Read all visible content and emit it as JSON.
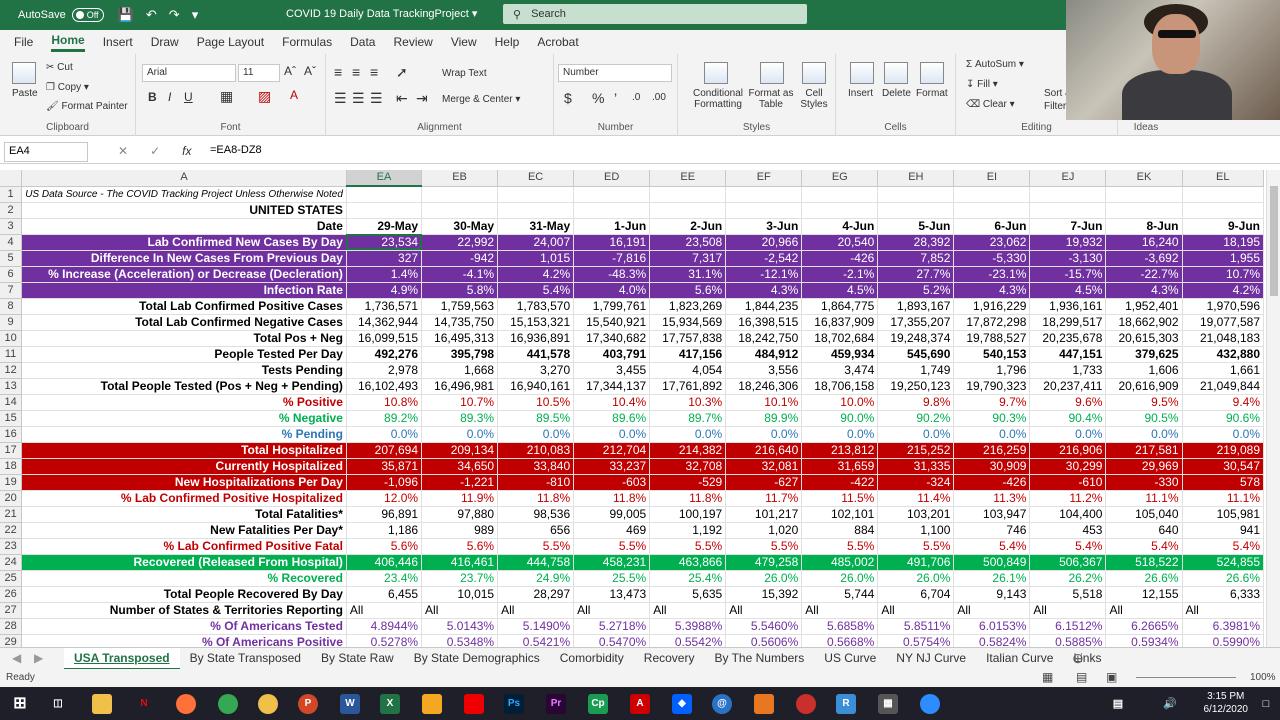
{
  "titlebar": {
    "autosave_label": "AutoSave",
    "autosave_state": "Off",
    "doc_title": "COVID 19 Daily Data TrackingProject",
    "search_placeholder": "Search"
  },
  "ribbon_tabs": [
    "File",
    "Home",
    "Insert",
    "Draw",
    "Page Layout",
    "Formulas",
    "Data",
    "Review",
    "View",
    "Help",
    "Acrobat"
  ],
  "ribbon": {
    "clipboard": {
      "paste": "Paste",
      "cut": "Cut",
      "copy": "Copy",
      "format_painter": "Format Painter",
      "label": "Clipboard"
    },
    "font": {
      "name": "Arial",
      "size": "11",
      "label": "Font"
    },
    "alignment": {
      "wrap": "Wrap Text",
      "merge": "Merge & Center",
      "label": "Alignment"
    },
    "number": {
      "format": "Number",
      "label": "Number"
    },
    "styles": {
      "conditional": "Conditional Formatting",
      "format_table": "Format as Table",
      "cell_styles": "Cell Styles",
      "label": "Styles"
    },
    "cells": {
      "insert": "Insert",
      "delete": "Delete",
      "format": "Format",
      "label": "Cells"
    },
    "editing": {
      "autosum": "AutoSum",
      "fill": "Fill",
      "clear": "Clear",
      "sort": "Sort &",
      "filter": "Filter",
      "label": "Editing"
    },
    "ideas": {
      "label": "Ideas"
    }
  },
  "formulabar": {
    "namebox": "EA4",
    "formula": "=EA8-DZ8"
  },
  "columns": [
    "A",
    "EA",
    "EB",
    "EC",
    "ED",
    "EE",
    "EF",
    "EG",
    "EH",
    "EI",
    "EJ",
    "EK",
    "EL"
  ],
  "rows": [
    {
      "n": "1",
      "label": "US Data Source - The COVID Tracking Project Unless Otherwise Noted",
      "style": "note",
      "vals": [
        "",
        "",
        "",
        "",
        "",
        "",
        "",
        "",
        "",
        "",
        "",
        ""
      ]
    },
    {
      "n": "2",
      "label": "UNITED STATES",
      "style": "bold",
      "vals": [
        "",
        "",
        "",
        "",
        "",
        "",
        "",
        "",
        "",
        "",
        "",
        ""
      ]
    },
    {
      "n": "3",
      "label": "Date",
      "style": "bold",
      "vals": [
        "29-May",
        "30-May",
        "31-May",
        "1-Jun",
        "2-Jun",
        "3-Jun",
        "4-Jun",
        "5-Jun",
        "6-Jun",
        "7-Jun",
        "8-Jun",
        "9-Jun"
      ],
      "valbold": true
    },
    {
      "n": "4",
      "label": "Lab Confirmed New Cases By Day",
      "style": "purple",
      "vals": [
        "23,534",
        "22,992",
        "24,007",
        "16,191",
        "23,508",
        "20,966",
        "20,540",
        "28,392",
        "23,062",
        "19,932",
        "16,240",
        "18,195"
      ]
    },
    {
      "n": "5",
      "label": "Difference In New Cases From Previous Day",
      "style": "purple",
      "vals": [
        "327",
        "-942",
        "1,015",
        "-7,816",
        "7,317",
        "-2,542",
        "-426",
        "7,852",
        "-5,330",
        "-3,130",
        "-3,692",
        "1,955"
      ]
    },
    {
      "n": "6",
      "label": "% Increase (Acceleration) or Decrease (Decleration)",
      "style": "purple",
      "vals": [
        "1.4%",
        "-4.1%",
        "4.2%",
        "-48.3%",
        "31.1%",
        "-12.1%",
        "-2.1%",
        "27.7%",
        "-23.1%",
        "-15.7%",
        "-22.7%",
        "10.7%"
      ]
    },
    {
      "n": "7",
      "label": "Infection Rate",
      "style": "purple",
      "vals": [
        "4.9%",
        "5.8%",
        "5.4%",
        "4.0%",
        "5.6%",
        "4.3%",
        "4.5%",
        "5.2%",
        "4.3%",
        "4.5%",
        "4.3%",
        "4.2%"
      ]
    },
    {
      "n": "8",
      "label": "Total Lab Confirmed Positive Cases",
      "style": "bold",
      "vals": [
        "1,736,571",
        "1,759,563",
        "1,783,570",
        "1,799,761",
        "1,823,269",
        "1,844,235",
        "1,864,775",
        "1,893,167",
        "1,916,229",
        "1,936,161",
        "1,952,401",
        "1,970,596"
      ]
    },
    {
      "n": "9",
      "label": "Total Lab Confirmed Negative Cases",
      "style": "bold",
      "vals": [
        "14,362,944",
        "14,735,750",
        "15,153,321",
        "15,540,921",
        "15,934,569",
        "16,398,515",
        "16,837,909",
        "17,355,207",
        "17,872,298",
        "18,299,517",
        "18,662,902",
        "19,077,587"
      ]
    },
    {
      "n": "10",
      "label": "Total Pos + Neg",
      "style": "bold",
      "vals": [
        "16,099,515",
        "16,495,313",
        "16,936,891",
        "17,340,682",
        "17,757,838",
        "18,242,750",
        "18,702,684",
        "19,248,374",
        "19,788,527",
        "20,235,678",
        "20,615,303",
        "21,048,183"
      ]
    },
    {
      "n": "11",
      "label": "People Tested Per Day",
      "style": "bold",
      "vals": [
        "492,276",
        "395,798",
        "441,578",
        "403,791",
        "417,156",
        "484,912",
        "459,934",
        "545,690",
        "540,153",
        "447,151",
        "379,625",
        "432,880"
      ],
      "valbold": true
    },
    {
      "n": "12",
      "label": "Tests Pending",
      "style": "bold",
      "vals": [
        "2,978",
        "1,668",
        "3,270",
        "3,455",
        "4,054",
        "3,556",
        "3,474",
        "1,749",
        "1,796",
        "1,733",
        "1,606",
        "1,661"
      ]
    },
    {
      "n": "13",
      "label": "Total People Tested (Pos + Neg + Pending)",
      "style": "bold",
      "vals": [
        "16,102,493",
        "16,496,981",
        "16,940,161",
        "17,344,137",
        "17,761,892",
        "18,246,306",
        "18,706,158",
        "19,250,123",
        "19,790,323",
        "20,237,411",
        "20,616,909",
        "21,049,844"
      ]
    },
    {
      "n": "14",
      "label": "% Positive",
      "style": "red",
      "vals": [
        "10.8%",
        "10.7%",
        "10.5%",
        "10.4%",
        "10.3%",
        "10.1%",
        "10.0%",
        "9.8%",
        "9.7%",
        "9.6%",
        "9.5%",
        "9.4%"
      ]
    },
    {
      "n": "15",
      "label": "% Negative",
      "style": "green",
      "vals": [
        "89.2%",
        "89.3%",
        "89.5%",
        "89.6%",
        "89.7%",
        "89.9%",
        "90.0%",
        "90.2%",
        "90.3%",
        "90.4%",
        "90.5%",
        "90.6%"
      ]
    },
    {
      "n": "16",
      "label": "% Pending",
      "style": "blue",
      "vals": [
        "0.0%",
        "0.0%",
        "0.0%",
        "0.0%",
        "0.0%",
        "0.0%",
        "0.0%",
        "0.0%",
        "0.0%",
        "0.0%",
        "0.0%",
        "0.0%"
      ]
    },
    {
      "n": "17",
      "label": "Total Hospitalized",
      "style": "redfill",
      "vals": [
        "207,694",
        "209,134",
        "210,083",
        "212,704",
        "214,382",
        "216,640",
        "213,812",
        "215,252",
        "216,259",
        "216,906",
        "217,581",
        "219,089"
      ]
    },
    {
      "n": "18",
      "label": "Currently Hospitalized",
      "style": "redfill",
      "vals": [
        "35,871",
        "34,650",
        "33,840",
        "33,237",
        "32,708",
        "32,081",
        "31,659",
        "31,335",
        "30,909",
        "30,299",
        "29,969",
        "30,547"
      ]
    },
    {
      "n": "19",
      "label": "New Hospitalizations Per Day",
      "style": "redfill",
      "vals": [
        "-1,096",
        "-1,221",
        "-810",
        "-603",
        "-529",
        "-627",
        "-422",
        "-324",
        "-426",
        "-610",
        "-330",
        "578"
      ]
    },
    {
      "n": "20",
      "label": "% Lab Confirmed Positive Hospitalized",
      "style": "red",
      "vals": [
        "12.0%",
        "11.9%",
        "11.8%",
        "11.8%",
        "11.8%",
        "11.7%",
        "11.5%",
        "11.4%",
        "11.3%",
        "11.2%",
        "11.1%",
        "11.1%"
      ]
    },
    {
      "n": "21",
      "label": "Total Fatalities*",
      "style": "bold",
      "vals": [
        "96,891",
        "97,880",
        "98,536",
        "99,005",
        "100,197",
        "101,217",
        "102,101",
        "103,201",
        "103,947",
        "104,400",
        "105,040",
        "105,981"
      ]
    },
    {
      "n": "22",
      "label": "New Fatalities Per Day*",
      "style": "bold",
      "vals": [
        "1,186",
        "989",
        "656",
        "469",
        "1,192",
        "1,020",
        "884",
        "1,100",
        "746",
        "453",
        "640",
        "941"
      ]
    },
    {
      "n": "23",
      "label": "% Lab Confirmed Positive Fatal",
      "style": "red",
      "vals": [
        "5.6%",
        "5.6%",
        "5.5%",
        "5.5%",
        "5.5%",
        "5.5%",
        "5.5%",
        "5.5%",
        "5.4%",
        "5.4%",
        "5.4%",
        "5.4%"
      ]
    },
    {
      "n": "24",
      "label": "Recovered (Released From Hospital)",
      "style": "greenfill",
      "vals": [
        "406,446",
        "416,461",
        "444,758",
        "458,231",
        "463,866",
        "479,258",
        "485,002",
        "491,706",
        "500,849",
        "506,367",
        "518,522",
        "524,855"
      ]
    },
    {
      "n": "25",
      "label": "% Recovered",
      "style": "green",
      "vals": [
        "23.4%",
        "23.7%",
        "24.9%",
        "25.5%",
        "25.4%",
        "26.0%",
        "26.0%",
        "26.0%",
        "26.1%",
        "26.2%",
        "26.6%",
        "26.6%"
      ]
    },
    {
      "n": "26",
      "label": "Total People Recovered By Day",
      "style": "bold",
      "vals": [
        "6,455",
        "10,015",
        "28,297",
        "13,473",
        "5,635",
        "15,392",
        "5,744",
        "6,704",
        "9,143",
        "5,518",
        "12,155",
        "6,333"
      ]
    },
    {
      "n": "27",
      "label": "Number of States & Territories Reporting",
      "style": "bold",
      "vals": [
        "All",
        "All",
        "All",
        "All",
        "All",
        "All",
        "All",
        "All",
        "All",
        "All",
        "All",
        "All"
      ],
      "valleft": true
    },
    {
      "n": "28",
      "label": "% Of Americans Tested",
      "style": "violet",
      "vals": [
        "4.8944%",
        "5.0143%",
        "5.1490%",
        "5.2718%",
        "5.3988%",
        "5.5460%",
        "5.6858%",
        "5.8511%",
        "6.0153%",
        "6.1512%",
        "6.2665%",
        "6.3981%"
      ]
    },
    {
      "n": "29",
      "label": "% Of Americans Positive",
      "style": "violet",
      "vals": [
        "0.5278%",
        "0.5348%",
        "0.5421%",
        "0.5470%",
        "0.5542%",
        "0.5606%",
        "0.5668%",
        "0.5754%",
        "0.5824%",
        "0.5885%",
        "0.5934%",
        "0.5990%"
      ]
    },
    {
      "n": "30",
      "label": "",
      "style": "plain",
      "vals": [
        "",
        "",
        "",
        "",
        "",
        "",
        "",
        "",
        "",
        "",
        "",
        ""
      ]
    }
  ],
  "sheet_tabs": [
    "USA Transposed",
    "By State Transposed",
    "By State Raw",
    "By State Demographics",
    "Comorbidity",
    "Recovery",
    "By The Numbers",
    "US Curve",
    "NY NJ Curve",
    "Italian Curve",
    "Links"
  ],
  "status": {
    "ready": "Ready",
    "zoom": "100%"
  },
  "clock": {
    "time": "3:15 PM",
    "date": "6/12/2020"
  },
  "colors": {
    "excel_green": "#217346",
    "purple_fill": "#7030a0",
    "red_fill": "#c00000",
    "green_fill": "#00b050",
    "red_text": "#c00000",
    "green_text": "#00b050",
    "blue_text": "#2e75b6",
    "violet_text": "#7030a0"
  }
}
